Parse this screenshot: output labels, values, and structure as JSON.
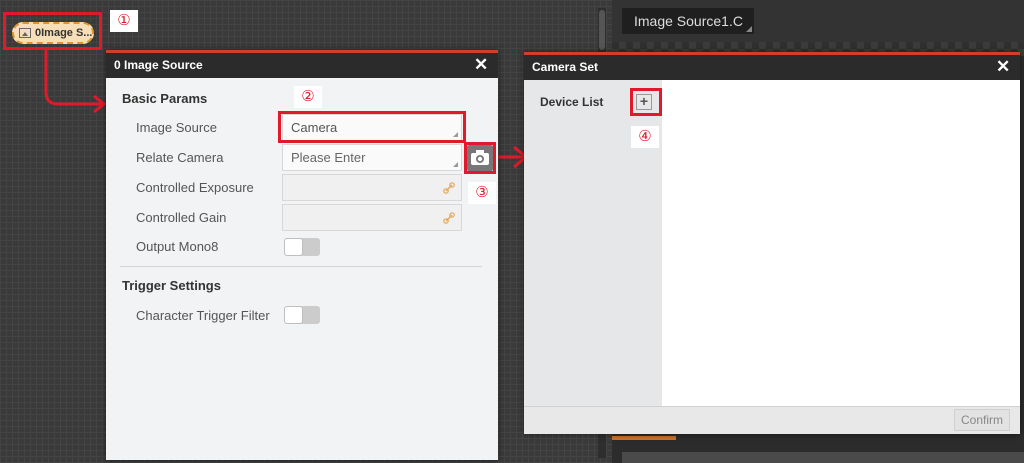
{
  "node": {
    "label": "0Image S..."
  },
  "annotations": {
    "a1": "①",
    "a2": "②",
    "a3": "③",
    "a4": "④"
  },
  "right_tab": {
    "label": "Image Source1.C"
  },
  "image_source_dialog": {
    "title": "0 Image Source",
    "basic_params": "Basic Params",
    "image_source_label": "Image Source",
    "image_source_value": "Camera",
    "relate_camera_label": "Relate Camera",
    "relate_camera_placeholder": "Please Enter",
    "controlled_exposure_label": "Controlled Exposure",
    "controlled_gain_label": "Controlled Gain",
    "output_mono8_label": "Output Mono8",
    "trigger_settings": "Trigger Settings",
    "character_trigger_filter_label": "Character Trigger Filter"
  },
  "camera_set_dialog": {
    "title": "Camera Set",
    "device_list_label": "Device List",
    "confirm_label": "Confirm"
  },
  "colors": {
    "highlight": "#e01a2a",
    "titlebar": "#2b2b2b",
    "title_accent": "#d63c2a",
    "node_fill": "#f6dfb8",
    "node_border": "#e0932f"
  }
}
